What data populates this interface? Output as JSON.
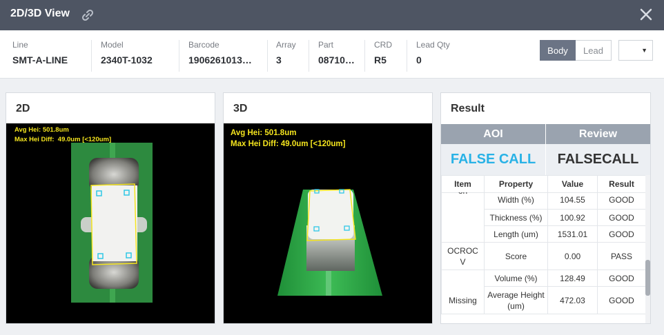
{
  "window": {
    "title": "2D/3D View"
  },
  "info": {
    "line_label": "Line",
    "line_value": "SMT-A-LINE",
    "model_label": "Model",
    "model_value": "2340T-1032",
    "barcode_label": "Barcode",
    "barcode_value": "1906261013…",
    "array_label": "Array",
    "array_value": "3",
    "part_label": "Part",
    "part_value": "08710…",
    "crd_label": "CRD",
    "crd_value": "R5",
    "leadqty_label": "Lead Qty",
    "leadqty_value": "0"
  },
  "toggle": {
    "body_label": "Body",
    "lead_label": "Lead",
    "selected": "Body"
  },
  "dropdown": {
    "value": "",
    "caret": "▼"
  },
  "panel2d": {
    "title": "2D",
    "avg_hei": "Avg Hei: 501.8um",
    "max_hei_diff": "Max Hei Diff:  49.0um [<120um]"
  },
  "panel3d": {
    "title": "3D",
    "avg_hei": "Avg Hei: 501.8um",
    "max_hei_diff": "Max Hei Diff: 49.0um [<120um]"
  },
  "result": {
    "title": "Result",
    "aoi_header": "AOI",
    "review_header": "Review",
    "aoi_value": "FALSE CALL",
    "review_value": "FALSECALL",
    "columns": [
      "Item",
      "Property",
      "Value",
      "Result"
    ],
    "rows": [
      {
        "item": "on",
        "property": "Width (%)",
        "value": "104.55",
        "result": "GOOD"
      },
      {
        "property": "Thickness (%)",
        "value": "100.92",
        "result": "GOOD"
      },
      {
        "property": "Length (um)",
        "value": "1531.01",
        "result": "GOOD"
      },
      {
        "item": "OCROC V",
        "property": "Score",
        "value": "0.00",
        "result": "PASS"
      },
      {
        "item": "Missing",
        "property": "Volume (%)",
        "value": "128.49",
        "result": "GOOD"
      },
      {
        "property": "Average Height (um)",
        "value": "472.03",
        "result": "GOOD"
      }
    ]
  },
  "colors": {
    "titlebar": "#4e5563",
    "aoi_value": "#29b2e6",
    "overlay_text": "#f5e51e",
    "board_green": "#2e9c47",
    "inspection_box": "#f5e51e",
    "pad_marker": "#2ec7e6"
  }
}
